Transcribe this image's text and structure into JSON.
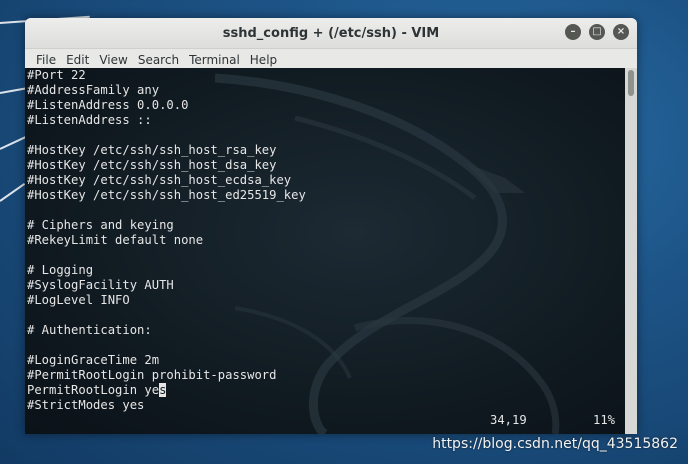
{
  "window": {
    "title": "sshd_config + (/etc/ssh) - VIM"
  },
  "menubar": {
    "items": [
      "File",
      "Edit",
      "View",
      "Search",
      "Terminal",
      "Help"
    ]
  },
  "editor": {
    "lines": [
      "#Port 22",
      "#AddressFamily any",
      "#ListenAddress 0.0.0.0",
      "#ListenAddress ::",
      "",
      "#HostKey /etc/ssh/ssh_host_rsa_key",
      "#HostKey /etc/ssh/ssh_host_dsa_key",
      "#HostKey /etc/ssh/ssh_host_ecdsa_key",
      "#HostKey /etc/ssh/ssh_host_ed25519_key",
      "",
      "# Ciphers and keying",
      "#RekeyLimit default none",
      "",
      "# Logging",
      "#SyslogFacility AUTH",
      "#LogLevel INFO",
      "",
      "# Authentication:",
      "",
      "#LoginGraceTime 2m",
      "#PermitRootLogin prohibit-password",
      "PermitRootLogin ye",
      "#StrictModes yes"
    ],
    "cursor_char": "s",
    "status_position": "34,19",
    "status_percent": "11%"
  },
  "watermark": "https://blog.csdn.net/qq_43515862",
  "colors": {
    "terminal_bg": "#101a21",
    "terminal_fg": "#e6e6e6",
    "desktop_bg": "#1d5487"
  }
}
